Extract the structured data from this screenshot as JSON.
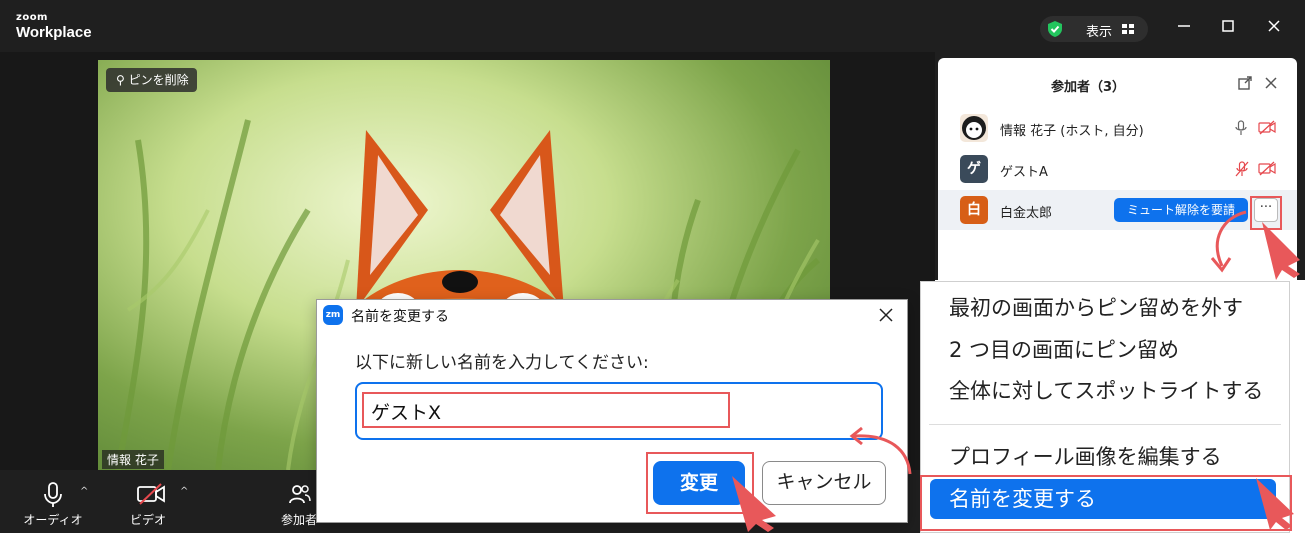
{
  "app": {
    "logo_small": "zoom",
    "logo_big": "Workplace"
  },
  "titlebar": {
    "view_label": "表示",
    "icons": [
      "shield-check-icon",
      "grid-icon",
      "minimize-icon",
      "maximize-icon",
      "close-icon"
    ]
  },
  "video": {
    "unpin_label": "ピンを削除",
    "participant_name": "情報 花子"
  },
  "toolbar": {
    "audio_label": "オーディオ",
    "video_label": "ビデオ",
    "participants_label": "参加者"
  },
  "participants_panel": {
    "title": "参加者（3）",
    "participants": [
      {
        "name": "情報 花子 (ホスト, 自分)",
        "avatar": ""
      },
      {
        "name": "ゲストA",
        "avatar": "ゲ"
      },
      {
        "name": "白金太郎",
        "avatar": "白",
        "unmute_label": "ミュート解除を要請",
        "more_label": "···"
      }
    ]
  },
  "context_menu": {
    "items": [
      "最初の画面からピン留めを外す",
      "2 つ目の画面にピン留め",
      "全体に対してスポットライトする",
      "プロフィール画像を編集する",
      "名前を変更する"
    ],
    "active_index": 4
  },
  "rename_dialog": {
    "icon_text": "zm",
    "title": "名前を変更する",
    "prompt": "以下に新しい名前を入力してください:",
    "input_value": "ゲストX",
    "change_label": "変更",
    "cancel_label": "キャンセル"
  },
  "colors": {
    "accent": "#0e72ed",
    "annotation": "#e8585a",
    "titlebar": "#1f1f1f"
  }
}
